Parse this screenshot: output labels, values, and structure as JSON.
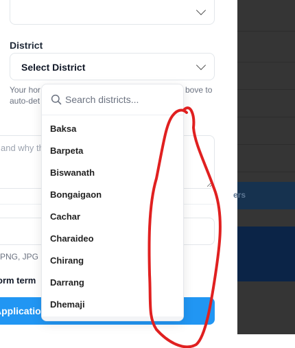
{
  "form": {
    "district_label": "District",
    "district_value": "Select District",
    "helper_line1": "Your hor",
    "helper_line2": "auto-det",
    "helper_right": "bove to",
    "textarea_placeholder": "and why th",
    "file_hint": "PNG, JPG u",
    "terms_text": "orm term",
    "submit_label": "Applicatio"
  },
  "background": {
    "band_text": "ers"
  },
  "dropdown": {
    "search_placeholder": "Search districts...",
    "options": [
      "Baksa",
      "Barpeta",
      "Biswanath",
      "Bongaigaon",
      "Cachar",
      "Charaideo",
      "Chirang",
      "Darrang",
      "Dhemaji"
    ]
  },
  "colors": {
    "accent": "#2196f3",
    "annotation": "#e02020",
    "overlay": "#353535"
  },
  "icons": [
    "chevron-down-icon",
    "search-icon"
  ]
}
